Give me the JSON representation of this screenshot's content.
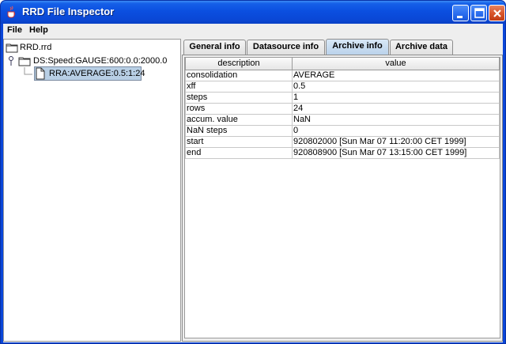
{
  "window": {
    "title": "RRD File Inspector",
    "icon": "java-cup-icon",
    "controls": [
      "minimize-icon",
      "maximize-icon",
      "close-icon"
    ]
  },
  "menu": {
    "file": "File",
    "help": "Help"
  },
  "tree": {
    "root": "RRD.rrd",
    "datasource": "DS:Speed:GAUGE:600:0.0:2000.0",
    "archive": "RRA:AVERAGE:0.5:1:24"
  },
  "tabs": [
    {
      "label": "General info",
      "active": false
    },
    {
      "label": "Datasource info",
      "active": false
    },
    {
      "label": "Archive info",
      "active": true
    },
    {
      "label": "Archive data",
      "active": false
    }
  ],
  "table": {
    "headers": [
      "description",
      "value"
    ],
    "rows": [
      [
        "consolidation",
        "AVERAGE"
      ],
      [
        "xff",
        "0.5"
      ],
      [
        "steps",
        "1"
      ],
      [
        "rows",
        "24"
      ],
      [
        "accum. value",
        "NaN"
      ],
      [
        "NaN steps",
        "0"
      ],
      [
        "start",
        "920802000 [Sun Mar 07 11:20:00 CET 1999]"
      ],
      [
        "end",
        "920808900 [Sun Mar 07 13:15:00 CET 1999]"
      ]
    ]
  },
  "colors": {
    "titlebar": "#0a48d6",
    "selection": "#b8cfe5",
    "active_tab": "#b9d1ea"
  }
}
